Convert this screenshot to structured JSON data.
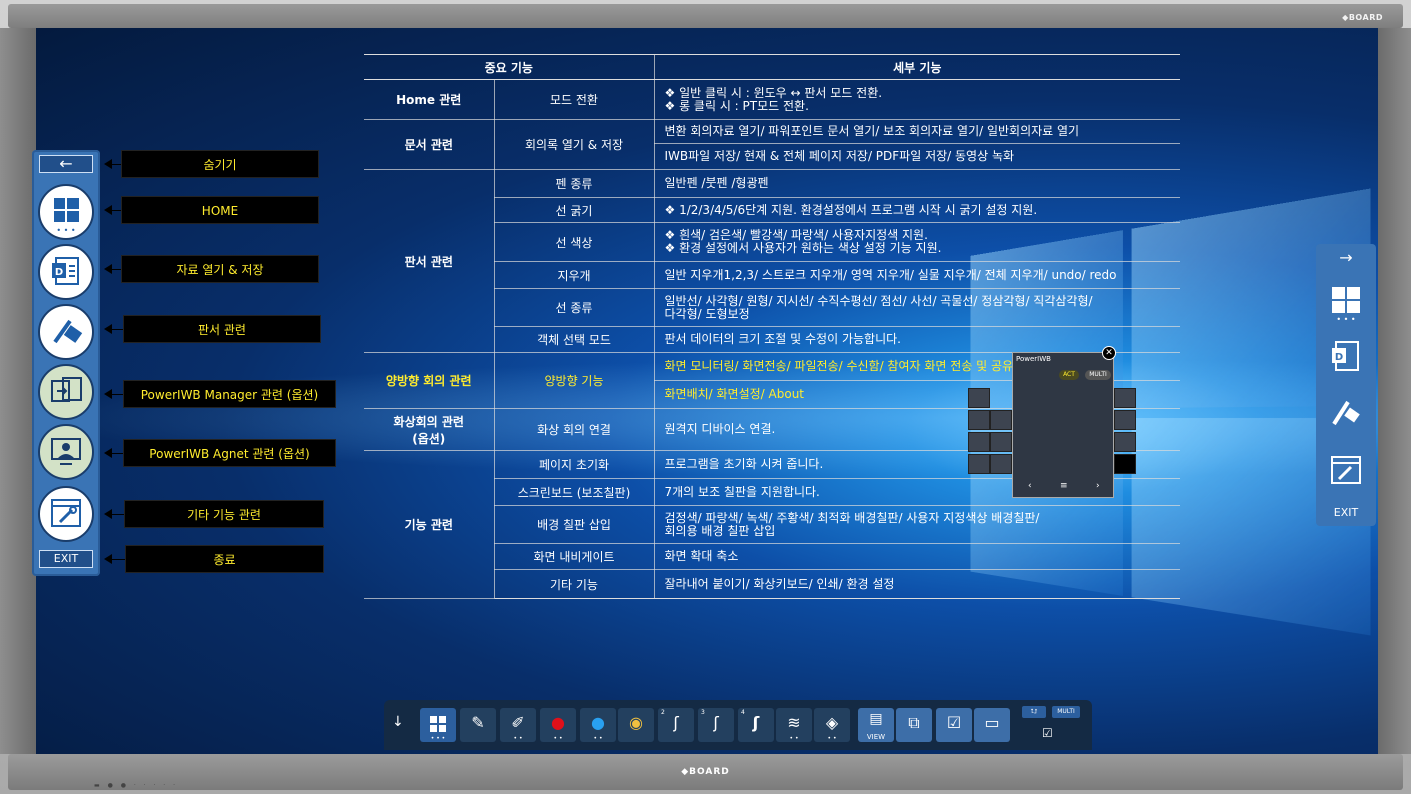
{
  "device": {
    "brand_top": "◆BOARD",
    "brand_bottom": "◆BOARD"
  },
  "table": {
    "header_main": "중요 기능",
    "header_detail": "세부 기능",
    "rows": [
      {
        "cat": "Home 관련",
        "sub": "모드 전환",
        "detail": "❖ 일반 클릭 시 : 윈도우 ↔ 판서 모드 전환.\n❖ 롱 클릭 시 : PT모드 전환."
      },
      {
        "cat": "문서 관련",
        "sub": "회의록 열기 & 저장",
        "detail": "변환 회의자료 열기/ 파워포인트 문서 열기/ 보조 회의자료 열기/ 일반회의자료 열기",
        "detail2": "IWB파일 저장/ 현재 & 전체 페이지 저장/ PDF파일 저장/ 동영상 녹화"
      },
      {
        "cat": "판서 관련",
        "sub": "펜 종류",
        "detail": "일반펜 /붓펜 /형광펜"
      },
      {
        "sub": "선 굵기",
        "detail": "❖ 1/2/3/4/5/6단계 지원. 환경설정에서 프로그램 시작 시 굵기 설정 지원."
      },
      {
        "sub": "선 색상",
        "detail": "❖ 흰색/ 검은색/ 빨강색/ 파랑색/ 사용자지정색 지원.\n❖ 환경 설정에서 사용자가 원하는 색상 설정 기능 지원."
      },
      {
        "sub": "지우개",
        "detail": "일반 지우개1,2,3/ 스트로크 지우개/ 영역 지우개/ 실물 지우개/ 전체 지우개/ undo/ redo"
      },
      {
        "sub": "선 종류",
        "detail": "일반선/ 사각형/ 원형/ 지시선/ 수직수평선/ 점선/ 사선/ 곡물선/ 정삼각형/ 직각삼각형/\n다각형/ 도형보정"
      },
      {
        "sub": "객체 선택 모드",
        "detail": "판서 데이터의 크기 조절 및 수정이 가능합니다."
      },
      {
        "cat": "양방향 회의 관련",
        "sub": "양방향 기능",
        "detail": "화면 모니터링/  화면전송/ 파일전송/ 수신함/ 참여자 화면 전송 및 공유",
        "detail2": "화면배치/ 화면설정/  About"
      },
      {
        "cat": "화상회의 관련\n(옵션)",
        "sub": "화상 회의 연결",
        "detail": "원격지 디바이스 연결."
      },
      {
        "cat": "기능 관련",
        "sub": "페이지 초기화",
        "detail": "프로그램을 초기화 시켜 줍니다."
      },
      {
        "sub": "스크린보드 (보조칠판)",
        "detail": "7개의 보조 칠판을 지원합니다."
      },
      {
        "sub": "배경 칠판 삽입",
        "detail": "검정색/ 파랑색/ 녹색/ 주황색/ 최적화 배경칠판/ 사용자 지정색상 배경칠판/\n회의용 배경 칠판 삽입"
      },
      {
        "sub": "화면 내비게이트",
        "detail": "화면 확대 축소"
      },
      {
        "sub": "기타 기능",
        "detail": " 잘라내어 붙이기/ 화상키보드/ 인쇄/ 환경 설정"
      }
    ]
  },
  "left_toolbar": {
    "hide_arrow": "←",
    "exit": "EXIT",
    "labels": {
      "hide": "숨기기",
      "home": "HOME",
      "doc": "자료  열기 & 저장",
      "pen": "판서 관련",
      "manager": "PowerIWB Manager 관련 (옵션)",
      "agent": "PowerIWB Agnet 관련 (옵션)",
      "tools": "기타 기능 관련",
      "exit": "종료"
    }
  },
  "right_toolbar": {
    "arrow": "→",
    "exit": "EXIT"
  },
  "mini_panel": {
    "title": "PowerIWB",
    "act": "ACT",
    "multi": "MULTI",
    "close": "✕",
    "nav_prev": "‹",
    "nav_menu": "≡",
    "nav_next": "›"
  },
  "bottom_toolbar": {
    "down_arrow": "↓",
    "multi": "MULTI",
    "num2": "2",
    "num3": "3",
    "num4": "4",
    "view": "VIEW"
  },
  "colors": {
    "toolbar_blue": "#3a74b5",
    "label_yellow": "#ffec2e",
    "highlight_yellow": "#ffec2e"
  }
}
